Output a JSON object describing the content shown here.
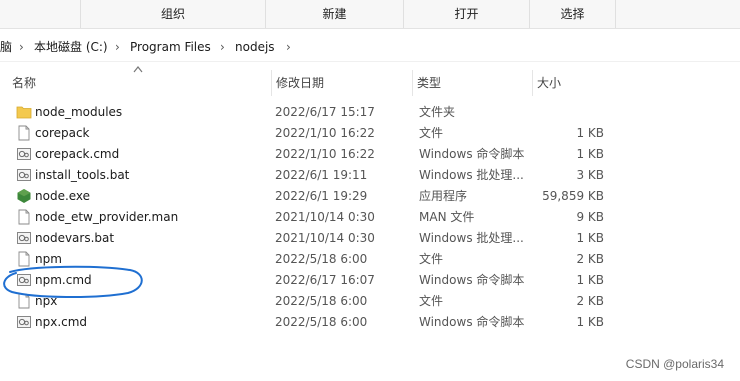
{
  "ribbon": {
    "groups": [
      "组织",
      "新建",
      "打开",
      "选择"
    ]
  },
  "breadcrumb": {
    "partial": "脑",
    "items": [
      "本地磁盘 (C:)",
      "Program Files",
      "nodejs"
    ],
    "separator": "›"
  },
  "columns": {
    "name": "名称",
    "date": "修改日期",
    "type": "类型",
    "size": "大小"
  },
  "files": [
    {
      "name": "node_modules",
      "date": "2022/6/17 15:17",
      "type": "文件夹",
      "size": "",
      "icon": "folder-icon"
    },
    {
      "name": "corepack",
      "date": "2022/1/10 16:22",
      "type": "文件",
      "size": "1 KB",
      "icon": "file-icon"
    },
    {
      "name": "corepack.cmd",
      "date": "2022/1/10 16:22",
      "type": "Windows 命令脚本",
      "size": "1 KB",
      "icon": "script-icon"
    },
    {
      "name": "install_tools.bat",
      "date": "2022/6/1 19:11",
      "type": "Windows 批处理...",
      "size": "3 KB",
      "icon": "script-icon"
    },
    {
      "name": "node.exe",
      "date": "2022/6/1 19:29",
      "type": "应用程序",
      "size": "59,859 KB",
      "icon": "nodejs-icon"
    },
    {
      "name": "node_etw_provider.man",
      "date": "2021/10/14 0:30",
      "type": "MAN 文件",
      "size": "9 KB",
      "icon": "file-icon"
    },
    {
      "name": "nodevars.bat",
      "date": "2021/10/14 0:30",
      "type": "Windows 批处理...",
      "size": "1 KB",
      "icon": "script-icon"
    },
    {
      "name": "npm",
      "date": "2022/5/18 6:00",
      "type": "文件",
      "size": "2 KB",
      "icon": "file-icon"
    },
    {
      "name": "npm.cmd",
      "date": "2022/6/17 16:07",
      "type": "Windows 命令脚本",
      "size": "1 KB",
      "icon": "script-icon"
    },
    {
      "name": "npx",
      "date": "2022/5/18 6:00",
      "type": "文件",
      "size": "2 KB",
      "icon": "file-icon"
    },
    {
      "name": "npx.cmd",
      "date": "2022/5/18 6:00",
      "type": "Windows 命令脚本",
      "size": "1 KB",
      "icon": "script-icon"
    }
  ],
  "watermark": "CSDN @polaris34",
  "colors": {
    "annotation": "#1f6fd1",
    "folder": "#f3c94f",
    "node": "#3c873a"
  }
}
